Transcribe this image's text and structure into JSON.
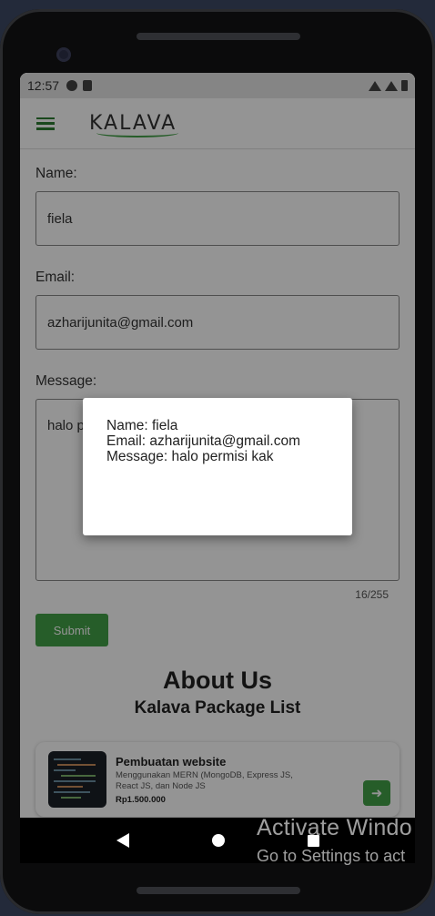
{
  "status_bar": {
    "time": "12:57"
  },
  "app_bar": {
    "logo_text": "KALAVA"
  },
  "form": {
    "name_label": "Name:",
    "name_value": "fiela",
    "email_label": "Email:",
    "email_value": "azharijunita@gmail.com",
    "message_label": "Message:",
    "message_value": "halo permisi kak",
    "char_counter": "16/255",
    "submit_label": "Submit"
  },
  "about": {
    "title": "About Us",
    "subtitle": "Kalava Package List"
  },
  "packages": [
    {
      "name": "Pembuatan website",
      "description": "Menggunakan MERN (MongoDB, Express JS, React JS, dan Node JS",
      "price": "Rp1.500.000",
      "action_icon": "arrow-right-icon"
    }
  ],
  "dialog": {
    "name_line": "Name: fiela",
    "email_line": "Email: azharijunita@gmail.com",
    "message_line": "Message: halo permisi kak"
  },
  "watermark": {
    "title": "Activate Windo",
    "subtitle": "Go to Settings to act"
  },
  "colors": {
    "accent": "#43a047",
    "scrim": "rgba(0,0,0,0.42)"
  }
}
